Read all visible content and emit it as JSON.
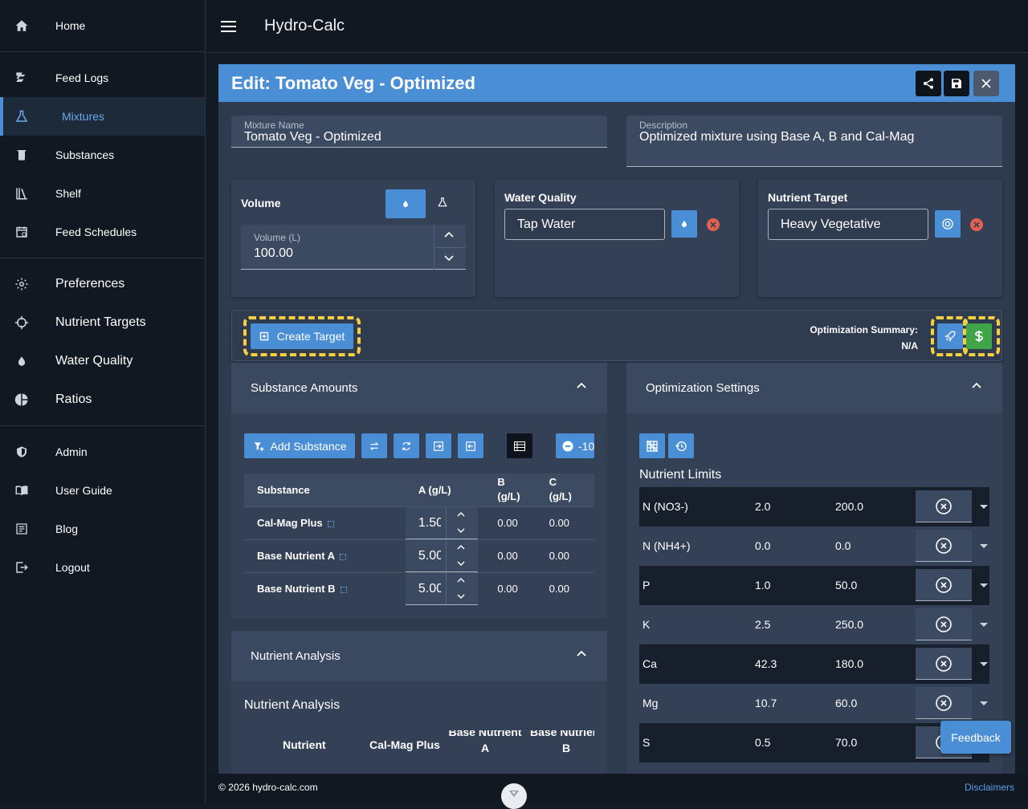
{
  "app": {
    "title": "Hydro-Calc"
  },
  "sidebar": {
    "groups": [
      [
        {
          "label": "Home",
          "icon": "home-icon"
        }
      ],
      [
        {
          "label": "Feed Logs",
          "icon": "feed-logs-icon"
        },
        {
          "label": "Mixtures",
          "icon": "flask-icon",
          "active": true
        },
        {
          "label": "Substances",
          "icon": "beaker-icon"
        },
        {
          "label": "Shelf",
          "icon": "shelf-icon"
        },
        {
          "label": "Feed Schedules",
          "icon": "calendar-icon"
        }
      ],
      [
        {
          "label": "Preferences",
          "icon": "gear-icon"
        },
        {
          "label": "Nutrient Targets",
          "icon": "crosshair-icon"
        },
        {
          "label": "Water Quality",
          "icon": "water-drop-icon"
        },
        {
          "label": "Ratios",
          "icon": "pie-chart-icon"
        }
      ],
      [
        {
          "label": "Admin",
          "icon": "shield-icon"
        },
        {
          "label": "User Guide",
          "icon": "book-icon"
        },
        {
          "label": "Blog",
          "icon": "blog-icon"
        },
        {
          "label": "Logout",
          "icon": "logout-icon"
        }
      ]
    ]
  },
  "editor": {
    "title": "Edit: Tomato Veg - Optimized",
    "mixture_name_label": "Mixture Name",
    "mixture_name": "Tomato Veg - Optimized",
    "description_label": "Description",
    "description": "Optimized mixture using Base A, B and Cal-Mag",
    "volume_title": "Volume",
    "volume_label": "Volume (L)",
    "volume_value": "100.00",
    "water_quality_title": "Water Quality",
    "water_quality_value": "Tap Water",
    "nutrient_target_title": "Nutrient Target",
    "nutrient_target_value": "Heavy Vegetative",
    "create_target_label": "Create Target",
    "opt_summary_label": "Optimization Summary:",
    "opt_summary_value": "N/A"
  },
  "substance_amounts": {
    "title": "Substance Amounts",
    "add_label": "Add Substance",
    "partial_btn": "-10",
    "headers": {
      "substance": "Substance",
      "a": "A (g/L)",
      "b_top": "B",
      "b_bot": "(g/L)",
      "c_top": "C",
      "c_bot": "(g/L)"
    },
    "rows": [
      {
        "name": "Cal-Mag Plus",
        "a": "1.50",
        "b": "0.00",
        "c": "0.00"
      },
      {
        "name": "Base Nutrient A",
        "a": "5.00",
        "b": "0.00",
        "c": "0.00"
      },
      {
        "name": "Base Nutrient B",
        "a": "5.00",
        "b": "0.00",
        "c": "0.00"
      }
    ]
  },
  "optimization": {
    "title": "Optimization Settings",
    "limits_title": "Nutrient Limits",
    "rows": [
      {
        "name": "N (NO3-)",
        "min": "2.0",
        "max": "200.0"
      },
      {
        "name": "N (NH4+)",
        "min": "0.0",
        "max": "0.0"
      },
      {
        "name": "P",
        "min": "1.0",
        "max": "50.0"
      },
      {
        "name": "K",
        "min": "2.5",
        "max": "250.0"
      },
      {
        "name": "Ca",
        "min": "42.3",
        "max": "180.0"
      },
      {
        "name": "Mg",
        "min": "10.7",
        "max": "60.0"
      },
      {
        "name": "S",
        "min": "0.5",
        "max": "70.0"
      }
    ]
  },
  "nutrient_analysis": {
    "title": "Nutrient Analysis",
    "subtitle": "Nutrient Analysis",
    "col_nutrient": "Nutrient",
    "col_calmag": "Cal-Mag Plus",
    "col_base_a_top": "Base Nutrient",
    "col_base_a_bot": "A",
    "col_base_b_top": "Base Nutrier",
    "col_base_b_bot": "B"
  },
  "footer": {
    "copyright": "© 2026 hydro-calc.com",
    "disclaimers": "Disclaimers",
    "feedback": "Feedback"
  },
  "colors": {
    "accent": "#4a8fd6",
    "highlight": "#f5cf3e",
    "success": "#3fa548",
    "danger": "#e4604f"
  }
}
